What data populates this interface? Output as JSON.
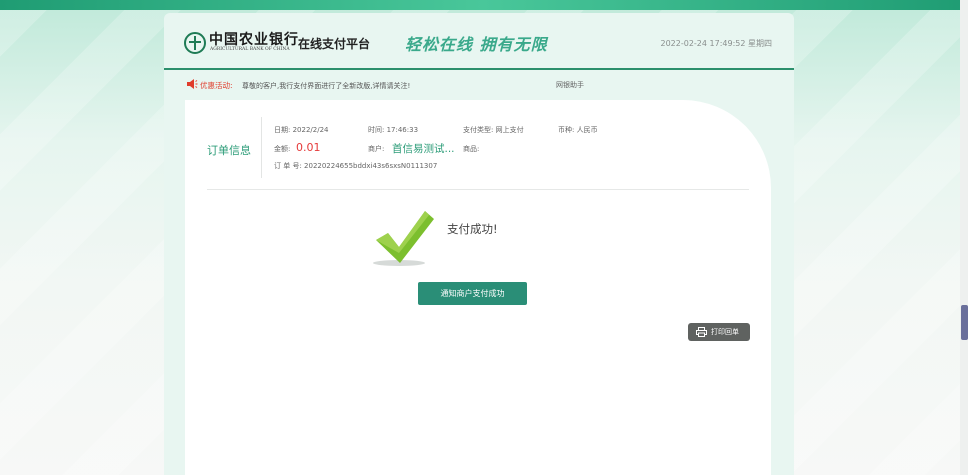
{
  "header": {
    "bank_name_cn": "中国农业银行",
    "bank_name_en": "AGRICULTURAL BANK OF CHINA",
    "platform": "在线支付平台",
    "slogan": "轻松在线  拥有无限",
    "datetime": "2022-02-24 17:49:52 星期四"
  },
  "notice": {
    "label": "优惠活动:",
    "text": "尊敬的客户,我行支付界面进行了全新改版,详情请关注!",
    "assistant": "网银助手"
  },
  "order": {
    "title": "订单信息",
    "date_label": "日期: 2022/2/24",
    "time_label": "时间: 17:46:33",
    "pay_type": "支付类型: 网上支付",
    "currency": "币种: 人民币",
    "amount_label": "金额:",
    "amount_value": "0.01",
    "merchant_label": "商户:",
    "merchant_value": "首信易测试...",
    "goods_label": "商品:",
    "order_no": "订 单 号: 20220224655bddxi43s6sxsN0111307"
  },
  "result": {
    "success_text": "支付成功!",
    "notify_button": "通知商户支付成功",
    "print_button": "打印回单"
  },
  "colors": {
    "brand_green": "#2a8e77",
    "accent_red": "#e53a3a",
    "header_line": "#2b8f6c"
  }
}
